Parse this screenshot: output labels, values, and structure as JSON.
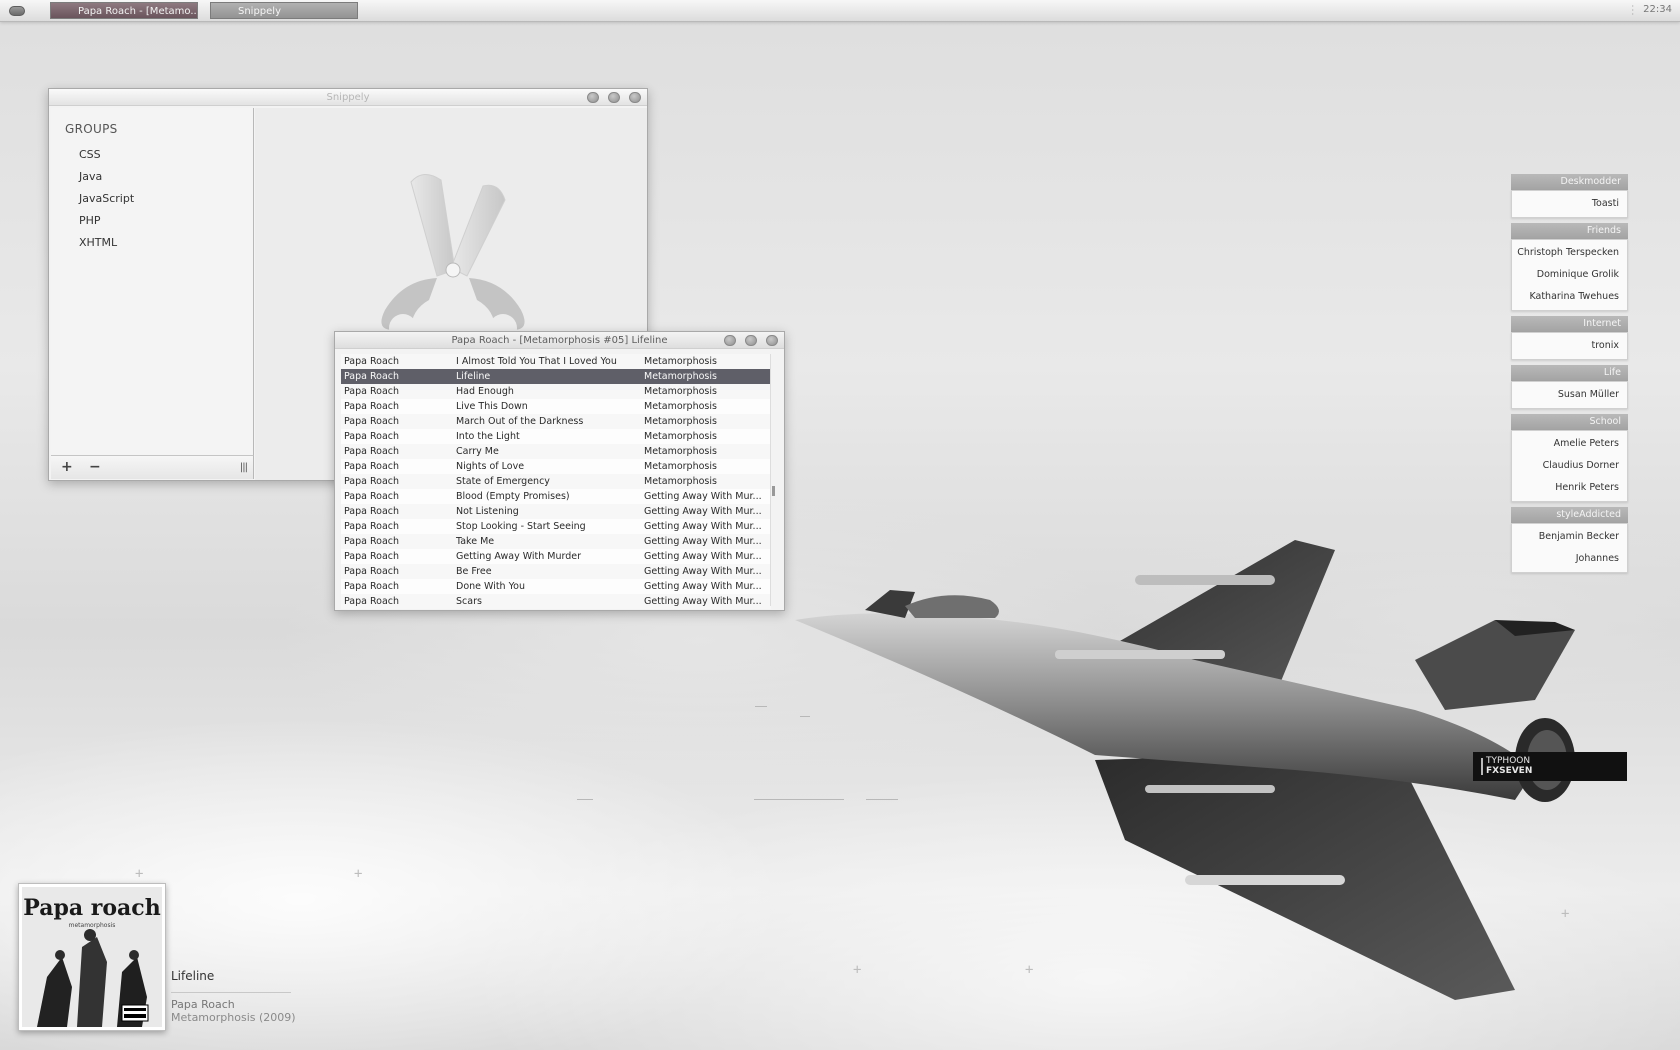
{
  "taskbar": {
    "tasks": [
      "Papa Roach - [Metamo...",
      "Snippely"
    ],
    "clock": "22:34"
  },
  "snippely": {
    "title": "Snippely",
    "groups_heading": "GROUPS",
    "groups": [
      "CSS",
      "Java",
      "JavaScript",
      "PHP",
      "XHTML"
    ],
    "add_label": "+",
    "remove_label": "−",
    "grip_label": "|||"
  },
  "player": {
    "title": "Papa Roach - [Metamorphosis #05] Lifeline",
    "tracks": [
      {
        "artist": "Papa Roach",
        "title": "I Almost Told You That I Loved You",
        "album": "Metamorphosis"
      },
      {
        "artist": "Papa Roach",
        "title": "Lifeline",
        "album": "Metamorphosis"
      },
      {
        "artist": "Papa Roach",
        "title": "Had Enough",
        "album": "Metamorphosis"
      },
      {
        "artist": "Papa Roach",
        "title": "Live This Down",
        "album": "Metamorphosis"
      },
      {
        "artist": "Papa Roach",
        "title": "March Out of the Darkness",
        "album": "Metamorphosis"
      },
      {
        "artist": "Papa Roach",
        "title": "Into the Light",
        "album": "Metamorphosis"
      },
      {
        "artist": "Papa Roach",
        "title": "Carry Me",
        "album": "Metamorphosis"
      },
      {
        "artist": "Papa Roach",
        "title": "Nights of Love",
        "album": "Metamorphosis"
      },
      {
        "artist": "Papa Roach",
        "title": "State of Emergency",
        "album": "Metamorphosis"
      },
      {
        "artist": "Papa Roach",
        "title": "Blood (Empty Promises)",
        "album": "Getting Away With Mur..."
      },
      {
        "artist": "Papa Roach",
        "title": "Not Listening",
        "album": "Getting Away With Mur..."
      },
      {
        "artist": "Papa Roach",
        "title": "Stop Looking - Start Seeing",
        "album": "Getting Away With Mur..."
      },
      {
        "artist": "Papa Roach",
        "title": "Take Me",
        "album": "Getting Away With Mur..."
      },
      {
        "artist": "Papa Roach",
        "title": "Getting Away With Murder",
        "album": "Getting Away With Mur..."
      },
      {
        "artist": "Papa Roach",
        "title": "Be Free",
        "album": "Getting Away With Mur..."
      },
      {
        "artist": "Papa Roach",
        "title": "Done With You",
        "album": "Getting Away With Mur..."
      },
      {
        "artist": "Papa Roach",
        "title": "Scars",
        "album": "Getting Away With Mur..."
      }
    ],
    "selected_index": 1
  },
  "contacts": {
    "groups": [
      {
        "name": "Deskmodder",
        "members": [
          "Toasti"
        ]
      },
      {
        "name": "Friends",
        "members": [
          "Christoph Terspecken",
          "Dominique Grolik",
          "Katharina Twehues"
        ]
      },
      {
        "name": "Internet",
        "members": [
          "tronix"
        ]
      },
      {
        "name": "Life",
        "members": [
          "Susan Müller"
        ]
      },
      {
        "name": "School",
        "members": [
          "Amelie Peters",
          "Claudius Dorner",
          "Henrik Peters"
        ]
      },
      {
        "name": "styleAddicted",
        "members": [
          "Benjamin Becker",
          "Johannes"
        ]
      }
    ]
  },
  "wallpaper_label": {
    "line1": "TYPHOON",
    "line2": "FXSEVEN"
  },
  "now_playing": {
    "title": "Lifeline",
    "artist": "Papa Roach",
    "album": "Metamorphosis (2009)",
    "cover_text": "Papa roach",
    "cover_subtext": "metamorphosis"
  }
}
